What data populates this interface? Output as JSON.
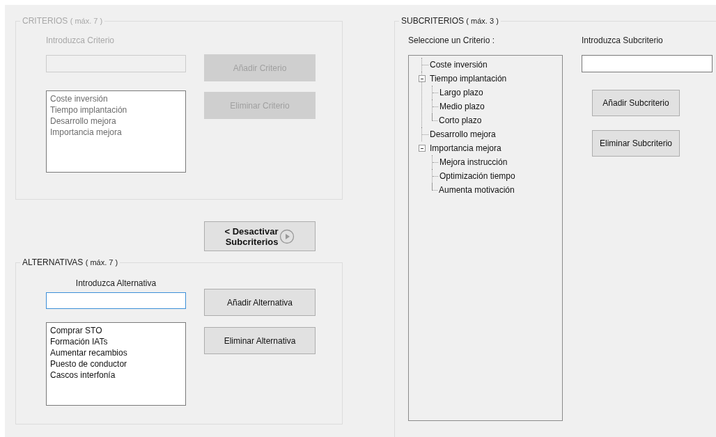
{
  "criterios": {
    "title": "CRITERIOS",
    "limit": "( máx. 7 )",
    "disabled": true,
    "input_label": "Introduzca Criterio",
    "items": [
      "Coste inversión",
      "Tiempo implantación",
      "Desarrollo mejora",
      "Importancia mejora"
    ],
    "buttons": [
      "Añadir Criterio",
      "Eliminar Criterio"
    ]
  },
  "toggle_button": {
    "lines": [
      "< Desactivar",
      "Subcriterios"
    ]
  },
  "alternativas": {
    "title": "ALTERNATIVAS",
    "limit": "( máx. 7 )",
    "disabled": false,
    "input_label": "Introduzca Alternativa",
    "focused": true,
    "items": [
      "Comprar STO",
      "Formación IATs",
      "Aumentar recambios",
      "Puesto de conductor",
      "Cascos interfonía"
    ],
    "buttons": [
      "Añadir Alternativa",
      "Eliminar Alternativa"
    ]
  },
  "subcriterios": {
    "title": "SUBCRITERIOS",
    "limit": "( máx. 3 )",
    "tree_label": "Seleccione un Criterio :",
    "input_label": "Introduzca Subcriterio",
    "tree": [
      {
        "label": "Coste inversión"
      },
      {
        "label": "Tiempo implantación",
        "expanded": true,
        "children": [
          {
            "label": "Largo plazo"
          },
          {
            "label": "Medio plazo"
          },
          {
            "label": "Corto plazo"
          }
        ]
      },
      {
        "label": "Desarrollo mejora"
      },
      {
        "label": "Importancia mejora",
        "expanded": true,
        "children": [
          {
            "label": "Mejora instrucción"
          },
          {
            "label": "Optimización tiempo"
          },
          {
            "label": "Aumenta motivación"
          }
        ]
      }
    ],
    "buttons": [
      "Añadir Subcriterio",
      "Eliminar Subcriterio"
    ]
  }
}
